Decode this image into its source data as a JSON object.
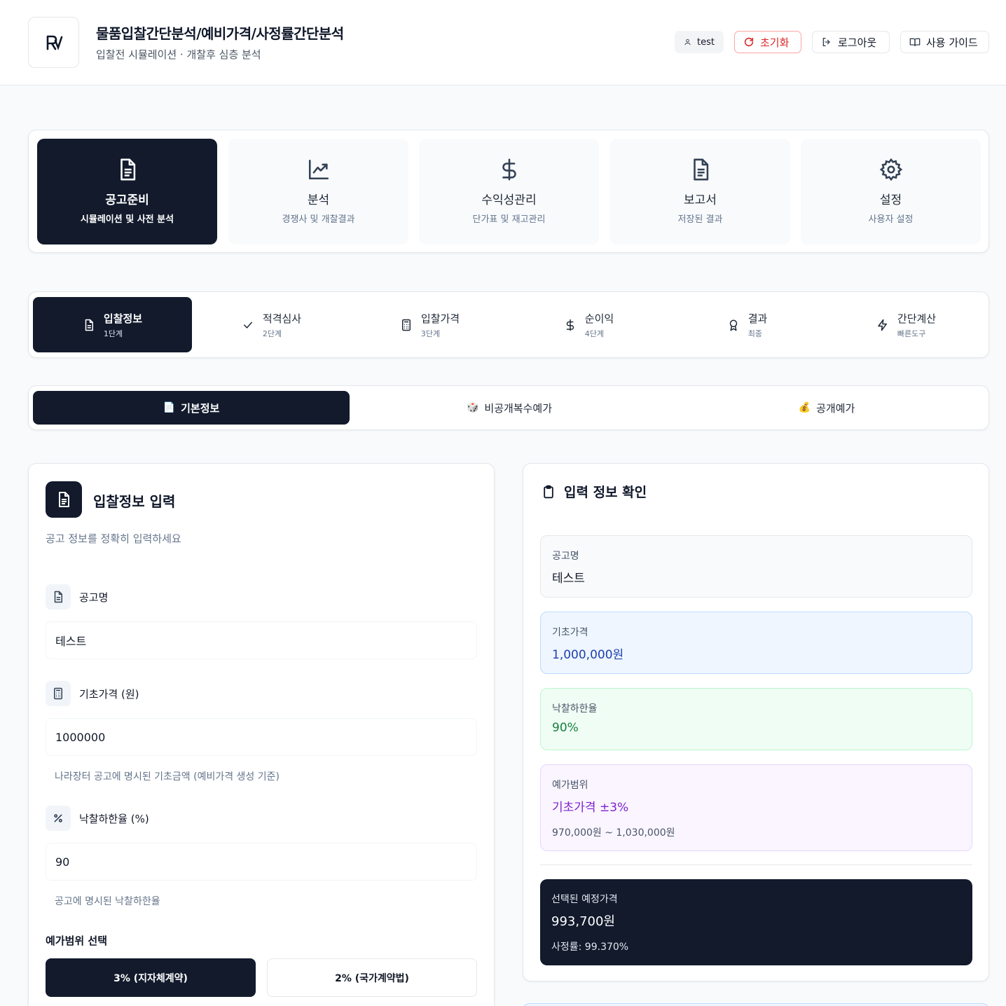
{
  "header": {
    "title": "물품입찰간단분석/예비가격/사정률간단분석",
    "subtitle": "입찰전 시뮬레이션 · 개찰후 심층 분석",
    "user_label": "test",
    "reset_label": "초기화",
    "logout_label": "로그아웃",
    "guide_label": "사용 가이드"
  },
  "main_nav": [
    {
      "title": "공고준비",
      "subtitle": "시뮬레이션 및 사전 분석",
      "icon": "document-icon",
      "active": true
    },
    {
      "title": "분석",
      "subtitle": "경쟁사 및 개찰결과",
      "icon": "chart-line-icon",
      "active": false
    },
    {
      "title": "수익성관리",
      "subtitle": "단가표 및 재고관리",
      "icon": "dollar-icon",
      "active": false
    },
    {
      "title": "보고서",
      "subtitle": "저장된 결과",
      "icon": "document-icon",
      "active": false
    },
    {
      "title": "설정",
      "subtitle": "사용자 설정",
      "icon": "gear-icon",
      "active": false
    }
  ],
  "steps": [
    {
      "title": "입찰정보",
      "subtitle": "1단계",
      "icon": "document-icon",
      "active": true
    },
    {
      "title": "적격심사",
      "subtitle": "2단계",
      "icon": "check-icon",
      "active": false
    },
    {
      "title": "입찰가격",
      "subtitle": "3단계",
      "icon": "calculator-icon",
      "active": false
    },
    {
      "title": "순이익",
      "subtitle": "4단계",
      "icon": "dollar-icon",
      "active": false
    },
    {
      "title": "결과",
      "subtitle": "최종",
      "icon": "award-icon",
      "active": false
    },
    {
      "title": "간단계산",
      "subtitle": "빠른도구",
      "icon": "zap-icon",
      "active": false
    }
  ],
  "sub_tabs": [
    {
      "label": "기본정보",
      "emoji": "📄",
      "active": true
    },
    {
      "label": "비공개복수예가",
      "emoji": "🎲",
      "active": false
    },
    {
      "label": "공개예가",
      "emoji": "💰",
      "active": false
    }
  ],
  "form": {
    "title": "입찰정보 입력",
    "description": "공고 정보를 정확히 입력하세요",
    "notice_label": "공고명",
    "notice_value": "테스트",
    "base_price_label": "기초가격 (원)",
    "base_price_value": "1000000",
    "base_price_hint": "나라장터 공고에 명시된 기초금액 (예비가격 생성 기준)",
    "min_rate_label": "낙찰하한율 (%)",
    "min_rate_value": "90",
    "min_rate_hint": "공고에 명시된 낙찰하한율",
    "range_label": "예가범위 선택",
    "range_options": [
      {
        "label": "3% (지자체계약)",
        "active": true
      },
      {
        "label": "2% (국가계약법)",
        "active": false
      }
    ]
  },
  "summary": {
    "title": "입력 정보 확인",
    "notice_key": "공고명",
    "notice_value": "테스트",
    "base_key": "기초가격",
    "base_value": "1,000,000원",
    "rate_key": "낙찰하한율",
    "rate_value": "90%",
    "range_key": "예가범위",
    "range_value": "기초가격 ±3%",
    "range_detail": "970,000원 ~ 1,030,000원",
    "selected_key": "선택된 예정가격",
    "selected_value": "993,700원",
    "selected_rate": "사정률: 99.370%"
  },
  "colors": {
    "navy": "#121a2c",
    "reset_red": "#dc2626",
    "blue_value": "#1e40af",
    "green_value": "#15803d",
    "purple_value": "#7e22ce"
  }
}
